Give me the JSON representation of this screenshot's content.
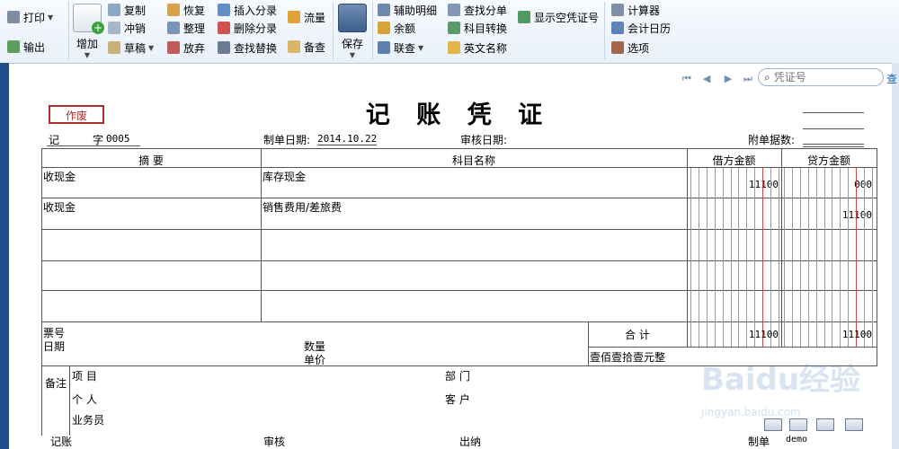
{
  "toolbar": {
    "print": "打印",
    "export": "输出",
    "add": "增加",
    "copy": "复制",
    "reverse": "冲销",
    "draft": "草稿",
    "restore": "恢复",
    "organize": "整理",
    "abandon": "放弃",
    "insert_entry": "插入分录",
    "delete_entry": "删除分录",
    "find_replace": "查找替换",
    "flow": "流量",
    "check": "备查",
    "save": "保存",
    "aux_detail": "辅助明细",
    "balance": "余额",
    "linked_query": "联查",
    "find_entry": "查找分单",
    "account_convert": "科目转换",
    "english_name": "英文名称",
    "show_empty_no": "显示空凭证号",
    "calculator": "计算器",
    "accounting_calendar": "会计日历",
    "options": "选项"
  },
  "search": {
    "placeholder": "凭证号",
    "button": "查"
  },
  "voucher": {
    "status_stamp": "作废",
    "title": "记 账 凭 证",
    "type_label": "记",
    "number_label": "字",
    "number": "0005",
    "date_label": "制单日期:",
    "date": "2014.10.22",
    "review_date_label": "审核日期:",
    "attachments_label": "附单据数:",
    "columns": {
      "summary": "摘 要",
      "account": "科目名称",
      "debit": "借方金额",
      "credit": "贷方金额"
    },
    "rows": [
      {
        "summary": "收现金",
        "account": "库存现金",
        "debit": "11100",
        "credit": "000"
      },
      {
        "summary": "收现金",
        "account": "销售费用/差旅费",
        "debit": "",
        "credit": "11100"
      },
      {
        "summary": "",
        "account": "",
        "debit": "",
        "credit": ""
      },
      {
        "summary": "",
        "account": "",
        "debit": "",
        "credit": ""
      },
      {
        "summary": "",
        "account": "",
        "debit": "",
        "credit": ""
      }
    ],
    "footer": {
      "ticket_no": "票号",
      "date": "日期",
      "quantity": "数量",
      "unit_price": "单价",
      "total_label": "合 计",
      "total_debit": "11100",
      "total_credit": "11100",
      "amount_in_words": "壹佰壹拾壹元整"
    },
    "remarks": {
      "label": "备注",
      "project": "项 目",
      "department": "部 门",
      "person": "个 人",
      "customer": "客 户",
      "salesperson": "业务员"
    },
    "signoff": {
      "bookkeeper": "记账",
      "reviewer": "审核",
      "cashier": "出纳",
      "preparer": "制单",
      "preparer_name": "demo"
    }
  },
  "watermark": {
    "logo": "Baidu经验",
    "url": "jingyan.baidu.com"
  },
  "colors": {
    "stamp": "#b22c2c",
    "toolbar_bg": "#eef3fa",
    "left_strip": "#1e4f8a"
  }
}
